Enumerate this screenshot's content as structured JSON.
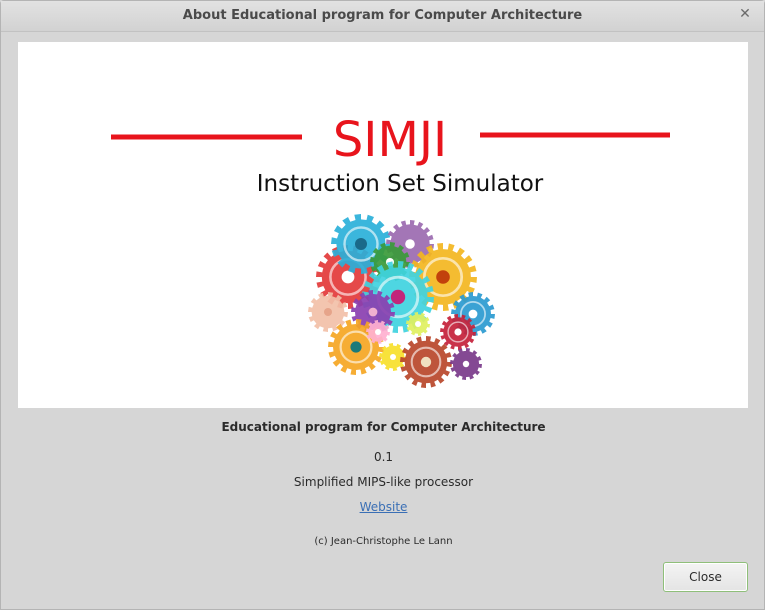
{
  "window": {
    "title": "About Educational program for Computer Architecture",
    "close_glyph": "✕"
  },
  "logo": {
    "brand": "SIMJI",
    "subtitle": "Instruction Set Simulator",
    "brand_color": "#e8141c",
    "image": "colorful-gears-illustration"
  },
  "about": {
    "program_name": "Educational program for Computer Architecture",
    "version": "0.1",
    "comments": "Simplified MIPS-like processor",
    "website_label": "Website",
    "copyright": "(c) Jean-Christophe Le Lann"
  },
  "actions": {
    "close_label": "Close"
  }
}
